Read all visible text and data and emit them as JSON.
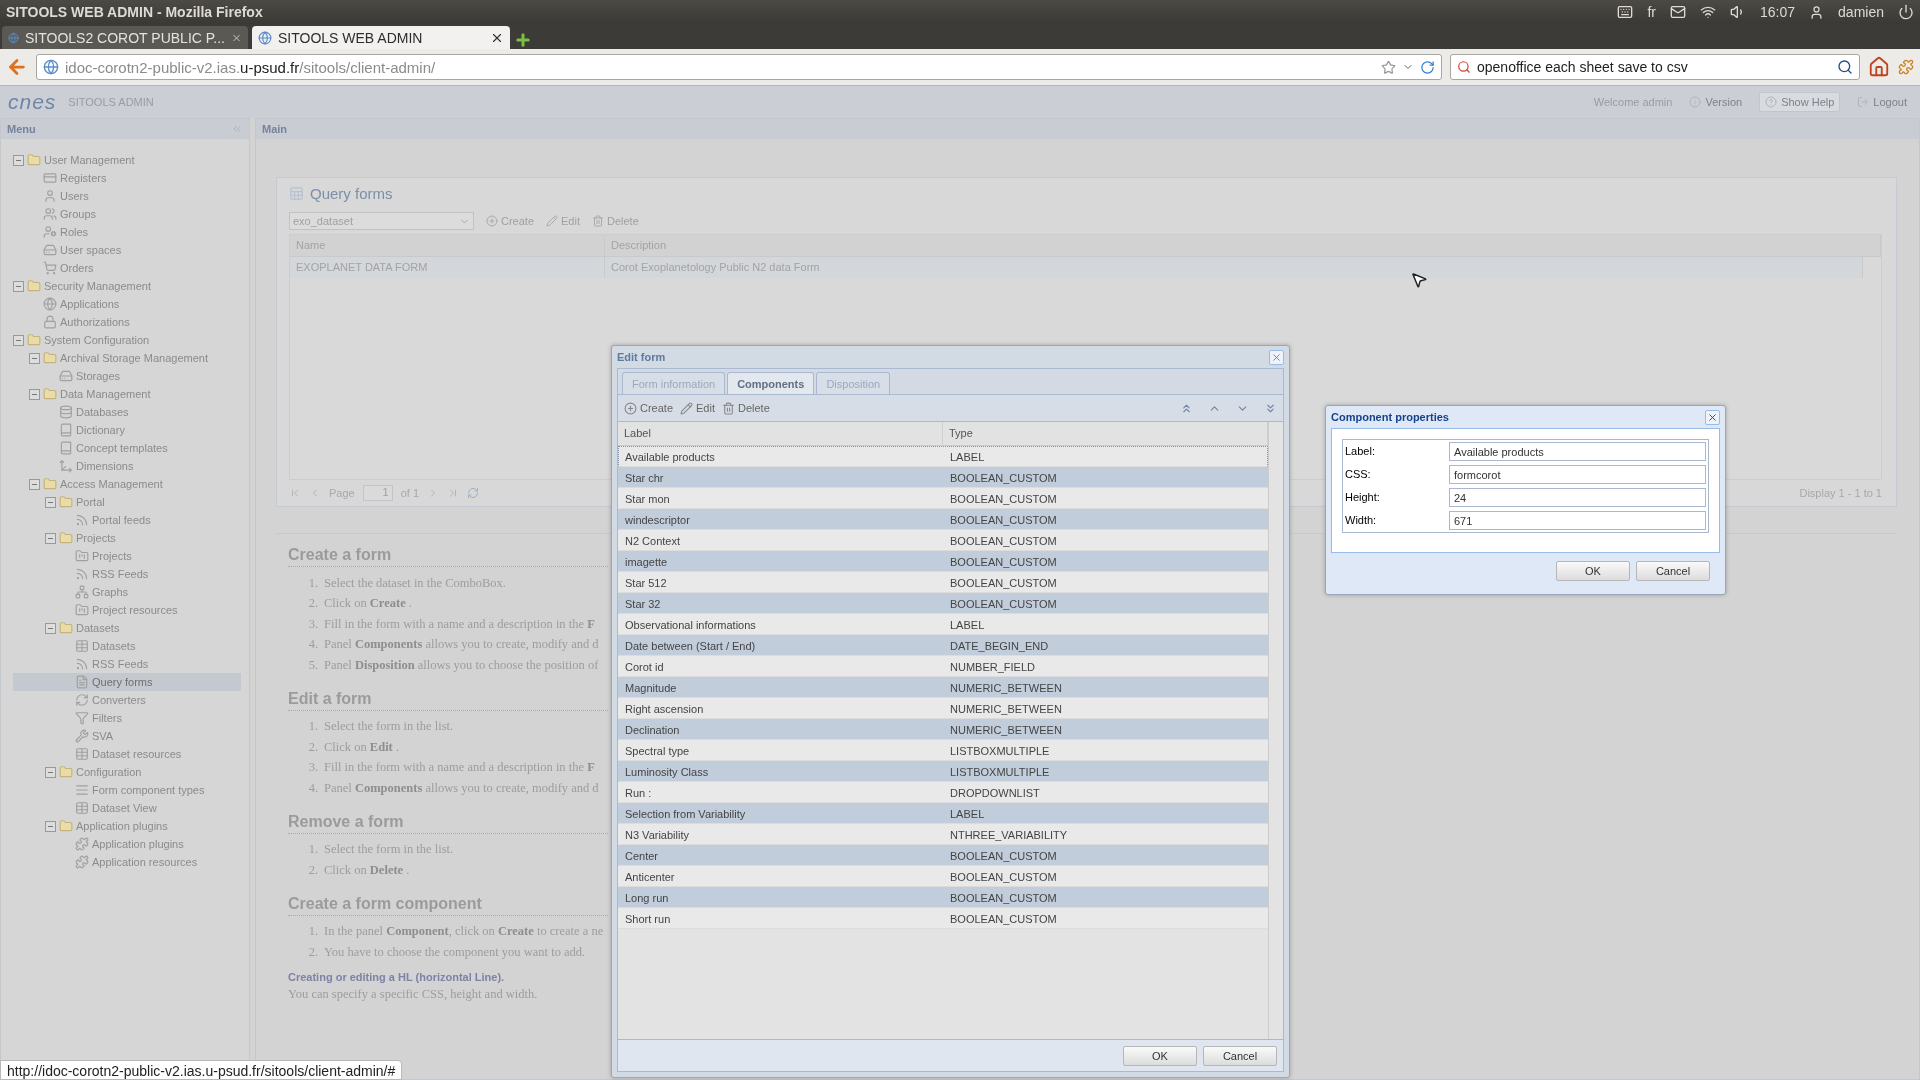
{
  "os_bar": {
    "title": "SITOOLS WEB ADMIN - Mozilla Firefox",
    "keyboard": "fr",
    "clock": "16:07",
    "user": "damien"
  },
  "browser": {
    "tabs": [
      {
        "label": "SITOOLS2 COROT PUBLIC P...",
        "selected": false
      },
      {
        "label": "SITOOLS WEB ADMIN",
        "selected": true
      }
    ],
    "url": {
      "before": "idoc-corotn2-public-v2.ias.",
      "domain": "u-psud.fr",
      "after": "/sitools/client-admin/"
    },
    "search": {
      "value": "openoffice each sheet save to csv"
    }
  },
  "app_header": {
    "logo": "cnes",
    "title": "SITOOLS ADMIN",
    "welcome": "Welcome admin",
    "links": [
      {
        "label": "Version",
        "kind": "link"
      },
      {
        "label": "Show Help",
        "kind": "button"
      },
      {
        "label": "Logout",
        "kind": "link"
      }
    ]
  },
  "menu": {
    "title": "Menu",
    "tree": [
      {
        "label": "User Management",
        "kind": "folder",
        "expanded": true,
        "selected": false,
        "children": [
          {
            "label": "Registers",
            "kind": "card",
            "selected": false
          },
          {
            "label": "Users",
            "kind": "user",
            "selected": false
          },
          {
            "label": "Groups",
            "kind": "group",
            "selected": false
          },
          {
            "label": "Roles",
            "kind": "role",
            "selected": false
          },
          {
            "label": "User spaces",
            "kind": "drive",
            "selected": false
          },
          {
            "label": "Orders",
            "kind": "cart",
            "selected": false
          }
        ]
      },
      {
        "label": "Security Management",
        "kind": "folder",
        "expanded": true,
        "selected": false,
        "children": [
          {
            "label": "Applications",
            "kind": "globe",
            "selected": false
          },
          {
            "label": "Authorizations",
            "kind": "lock",
            "selected": false
          }
        ]
      },
      {
        "label": "System Configuration",
        "kind": "folder",
        "expanded": true,
        "selected": false,
        "children": [
          {
            "label": "Archival Storage Management",
            "kind": "folder",
            "expanded": true,
            "selected": false,
            "children": [
              {
                "label": "Storages",
                "kind": "drive",
                "selected": false
              }
            ]
          },
          {
            "label": "Data Management",
            "kind": "folder",
            "expanded": true,
            "selected": false,
            "children": [
              {
                "label": "Databases",
                "kind": "database",
                "selected": false
              },
              {
                "label": "Dictionary",
                "kind": "book",
                "selected": false
              },
              {
                "label": "Concept templates",
                "kind": "book",
                "selected": false
              },
              {
                "label": "Dimensions",
                "kind": "axes",
                "selected": false
              }
            ]
          },
          {
            "label": "Access Management",
            "kind": "folder",
            "expanded": true,
            "selected": false,
            "children": [
              {
                "label": "Portal",
                "kind": "folder",
                "expanded": true,
                "selected": false,
                "children": [
                  {
                    "label": "Portal feeds",
                    "kind": "rss",
                    "selected": false
                  }
                ]
              },
              {
                "label": "Projects",
                "kind": "folder",
                "expanded": true,
                "selected": false,
                "children": [
                  {
                    "label": "Projects",
                    "kind": "project",
                    "selected": false
                  },
                  {
                    "label": "RSS Feeds",
                    "kind": "rss",
                    "selected": false
                  },
                  {
                    "label": "Graphs",
                    "kind": "graph",
                    "selected": false
                  },
                  {
                    "label": "Project resources",
                    "kind": "project",
                    "selected": false
                  }
                ]
              },
              {
                "label": "Datasets",
                "kind": "folder",
                "expanded": true,
                "selected": false,
                "children": [
                  {
                    "label": "Datasets",
                    "kind": "table",
                    "selected": false
                  },
                  {
                    "label": "RSS Feeds",
                    "kind": "rss",
                    "selected": false
                  },
                  {
                    "label": "Query forms",
                    "kind": "form",
                    "selected": true
                  },
                  {
                    "label": "Converters",
                    "kind": "convert",
                    "selected": false
                  },
                  {
                    "label": "Filters",
                    "kind": "filter",
                    "selected": false
                  },
                  {
                    "label": "SVA",
                    "kind": "tool",
                    "selected": false
                  },
                  {
                    "label": "Dataset resources",
                    "kind": "table",
                    "selected": false
                  }
                ]
              },
              {
                "label": "Configuration",
                "kind": "folder",
                "expanded": true,
                "selected": false,
                "children": [
                  {
                    "label": "Form component types",
                    "kind": "lines",
                    "selected": false
                  },
                  {
                    "label": "Dataset View",
                    "kind": "table",
                    "selected": false
                  }
                ]
              },
              {
                "label": "Application plugins",
                "kind": "folder",
                "expanded": true,
                "selected": false,
                "children": [
                  {
                    "label": "Application plugins",
                    "kind": "plugin",
                    "selected": false
                  },
                  {
                    "label": "Application resources",
                    "kind": "plugin",
                    "selected": false
                  }
                ]
              }
            ]
          }
        ]
      }
    ]
  },
  "main": {
    "title": "Main",
    "query_forms": {
      "title": "Query forms",
      "combo": "exo_dataset",
      "toolbar": [
        "Create",
        "Edit",
        "Delete"
      ],
      "columns": [
        "Name",
        "Description"
      ],
      "rows": [
        {
          "name": "EXOPLANET DATA FORM",
          "description": "Corot Exoplanetology Public N2 data Form"
        }
      ],
      "pager": {
        "page_label": "Page",
        "page": "1",
        "of": "of 1",
        "display": "Display 1 - 1 to 1"
      }
    },
    "help": [
      {
        "heading": "Create a form",
        "steps": [
          {
            "number": "1.",
            "text": "Select the dataset in the ComboBox."
          },
          {
            "number": "2.",
            "text": "Click on **Create** ."
          },
          {
            "number": "3.",
            "text": "Fill in the form with a name and a description in the **F**"
          },
          {
            "number": "4.",
            "text": "Panel **Components** allows you to create, modify and d"
          },
          {
            "number": "5.",
            "text": "Panel **Disposition** allows you to choose the position of"
          }
        ]
      },
      {
        "heading": "Edit a form",
        "steps": [
          {
            "number": "1.",
            "text": "Select the form in the list."
          },
          {
            "number": "2.",
            "text": "Click on **Edit** ."
          },
          {
            "number": "3.",
            "text": "Fill in the form with a name and a description in the **F**"
          },
          {
            "number": "4.",
            "text": "Panel **Components** allows you to create, modify and d"
          }
        ]
      },
      {
        "heading": "Remove a form",
        "steps": [
          {
            "number": "1.",
            "text": "Select the form in the list."
          },
          {
            "number": "2.",
            "text": "Click on **Delete** ."
          }
        ]
      },
      {
        "heading": "Create a form component",
        "steps": [
          {
            "number": "1.",
            "text": "In the panel **Component**, click on **Create** to create a ne"
          },
          {
            "number": "2.",
            "text": "You have to choose the component you want to add."
          }
        ],
        "note_title": "Creating or editing a HL (horizontal Line).",
        "note": "You can specify a specific CSS, height and width."
      }
    ]
  },
  "edit_form": {
    "title": "Edit form",
    "tabs": [
      {
        "label": "Form information",
        "selected": false
      },
      {
        "label": "Components",
        "selected": true
      },
      {
        "label": "Disposition",
        "selected": false
      }
    ],
    "toolbar": [
      "Create",
      "Edit",
      "Delete"
    ],
    "columns": [
      "Label",
      "Type"
    ],
    "rows": [
      {
        "label": "Available products",
        "type": "LABEL",
        "selected": true
      },
      {
        "label": "Star chr",
        "type": "BOOLEAN_CUSTOM",
        "selected": false
      },
      {
        "label": "Star mon",
        "type": "BOOLEAN_CUSTOM",
        "selected": false
      },
      {
        "label": "windescriptor",
        "type": "BOOLEAN_CUSTOM",
        "selected": false
      },
      {
        "label": "N2 Context",
        "type": "BOOLEAN_CUSTOM",
        "selected": false
      },
      {
        "label": "imagette",
        "type": "BOOLEAN_CUSTOM",
        "selected": false
      },
      {
        "label": "Star 512",
        "type": "BOOLEAN_CUSTOM",
        "selected": false
      },
      {
        "label": "Star 32",
        "type": "BOOLEAN_CUSTOM",
        "selected": false
      },
      {
        "label": "Observational informations",
        "type": "LABEL",
        "selected": false
      },
      {
        "label": "Date between (Start / End)",
        "type": "DATE_BEGIN_END",
        "selected": false
      },
      {
        "label": "Corot id",
        "type": "NUMBER_FIELD",
        "selected": false
      },
      {
        "label": "Magnitude",
        "type": "NUMERIC_BETWEEN",
        "selected": false
      },
      {
        "label": "Right ascension",
        "type": "NUMERIC_BETWEEN",
        "selected": false
      },
      {
        "label": "Declination",
        "type": "NUMERIC_BETWEEN",
        "selected": false
      },
      {
        "label": "Spectral type",
        "type": "LISTBOXMULTIPLE",
        "selected": false
      },
      {
        "label": "Luminosity Class",
        "type": "LISTBOXMULTIPLE",
        "selected": false
      },
      {
        "label": "Run :",
        "type": "DROPDOWNLIST",
        "selected": false
      },
      {
        "label": "Selection from Variability",
        "type": "LABEL",
        "selected": false
      },
      {
        "label": "N3 Variability",
        "type": "NTHREE_VARIABILITY",
        "selected": false
      },
      {
        "label": "Center",
        "type": "BOOLEAN_CUSTOM",
        "selected": false
      },
      {
        "label": "Anticenter",
        "type": "BOOLEAN_CUSTOM",
        "selected": false
      },
      {
        "label": "Long run",
        "type": "BOOLEAN_CUSTOM",
        "selected": false
      },
      {
        "label": "Short run",
        "type": "BOOLEAN_CUSTOM",
        "selected": false
      }
    ],
    "buttons": [
      "OK",
      "Cancel"
    ]
  },
  "component_properties": {
    "title": "Component properties",
    "fields": [
      {
        "label": "Label:",
        "value": "Available products"
      },
      {
        "label": "CSS:",
        "value": "formcorot"
      },
      {
        "label": "Height:",
        "value": "24"
      },
      {
        "label": "Width:",
        "value": "671"
      }
    ],
    "buttons": [
      "OK",
      "Cancel"
    ]
  },
  "status_link": "http://idoc-corotn2-public-v2.ias.u-psud.fr/sitools/client-admin/#"
}
